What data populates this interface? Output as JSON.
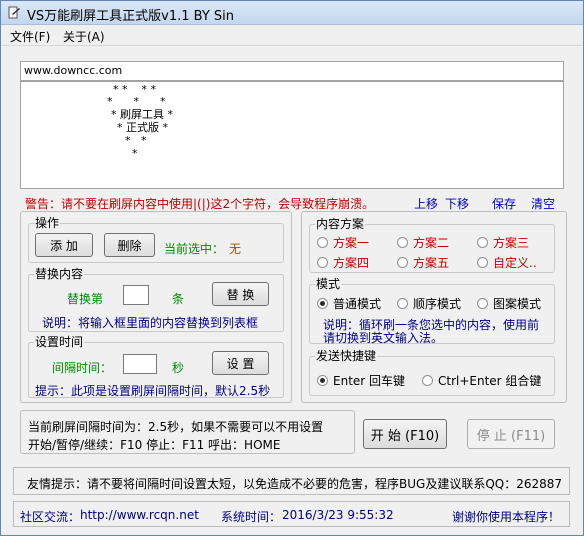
{
  "window": {
    "title": "VS万能刷屏工具正式版v1.1    BY Sin"
  },
  "menu": {
    "file": "文件(F)",
    "about": "关于(A)"
  },
  "editor": {
    "url": "www.downcc.com",
    "art_lines": [
      "* *    * *",
      "*      *      *",
      "* 刷屏工具 *",
      "* 正式版 *",
      "*   *",
      "*"
    ]
  },
  "warning": "警告：请不要在刷屏内容中使用|(|)这2个字符，会导致程序崩溃。",
  "edit_toolbar": {
    "up": "上移",
    "down": "下移",
    "save": "保存",
    "clear": "清空"
  },
  "ops": {
    "title": "操作",
    "add": "添 加",
    "delete": "删除",
    "current_label": "当前选中：",
    "current_value": "无"
  },
  "replace": {
    "title": "替换内容",
    "label_pre": "替换第",
    "label_post": "条",
    "button": "替 换",
    "note": "说明：将输入框里面的内容替换到列表框"
  },
  "interval": {
    "title": "设置时间",
    "label": "间隔时间：",
    "unit": "秒",
    "button": "设 置",
    "note": "提示：此项是设置刷屏间隔时间，默认2.5秒"
  },
  "schemes": {
    "title": "内容方案",
    "items": [
      "方案一",
      "方案二",
      "方案三",
      "方案四",
      "方案五",
      "自定义.."
    ],
    "selected": ""
  },
  "mode": {
    "title": "模式",
    "options": [
      "普通模式",
      "顺序模式",
      "图案模式"
    ],
    "selected": "普通模式",
    "note_line1": "说明：循环刷一条您选中的内容，使用前",
    "note_line2": "请切换到英文输入法。"
  },
  "hotkey": {
    "title": "发送快捷键",
    "options": [
      "Enter 回车键",
      "Ctrl+Enter 组合键"
    ],
    "selected": "Enter 回车键"
  },
  "info": {
    "line1": "当前刷屏间隔时间为：2.5秒，如果不需要可以不用设置",
    "line2": "开始/暂停/继续：F10    停止：F11    呼出：HOME"
  },
  "controls": {
    "start": "开 始 (F10)",
    "stop": "停 止 (F11)"
  },
  "status_tip": "友情提示：请不要将间隔时间设置太短，以免造成不必要的危害，程序BUG及建议联系QQ：262887",
  "footer": {
    "community_label": "社区交流：",
    "community_url": "http://www.rcqn.net",
    "time_label": "系统时间：",
    "time_value": "2016/3/23 9:55:32",
    "thanks": "谢谢你使用本程序！"
  },
  "colors": {
    "warning": "#c00000",
    "link": "#0000c0",
    "label_green": "#008a00",
    "note_blue": "#000080"
  }
}
